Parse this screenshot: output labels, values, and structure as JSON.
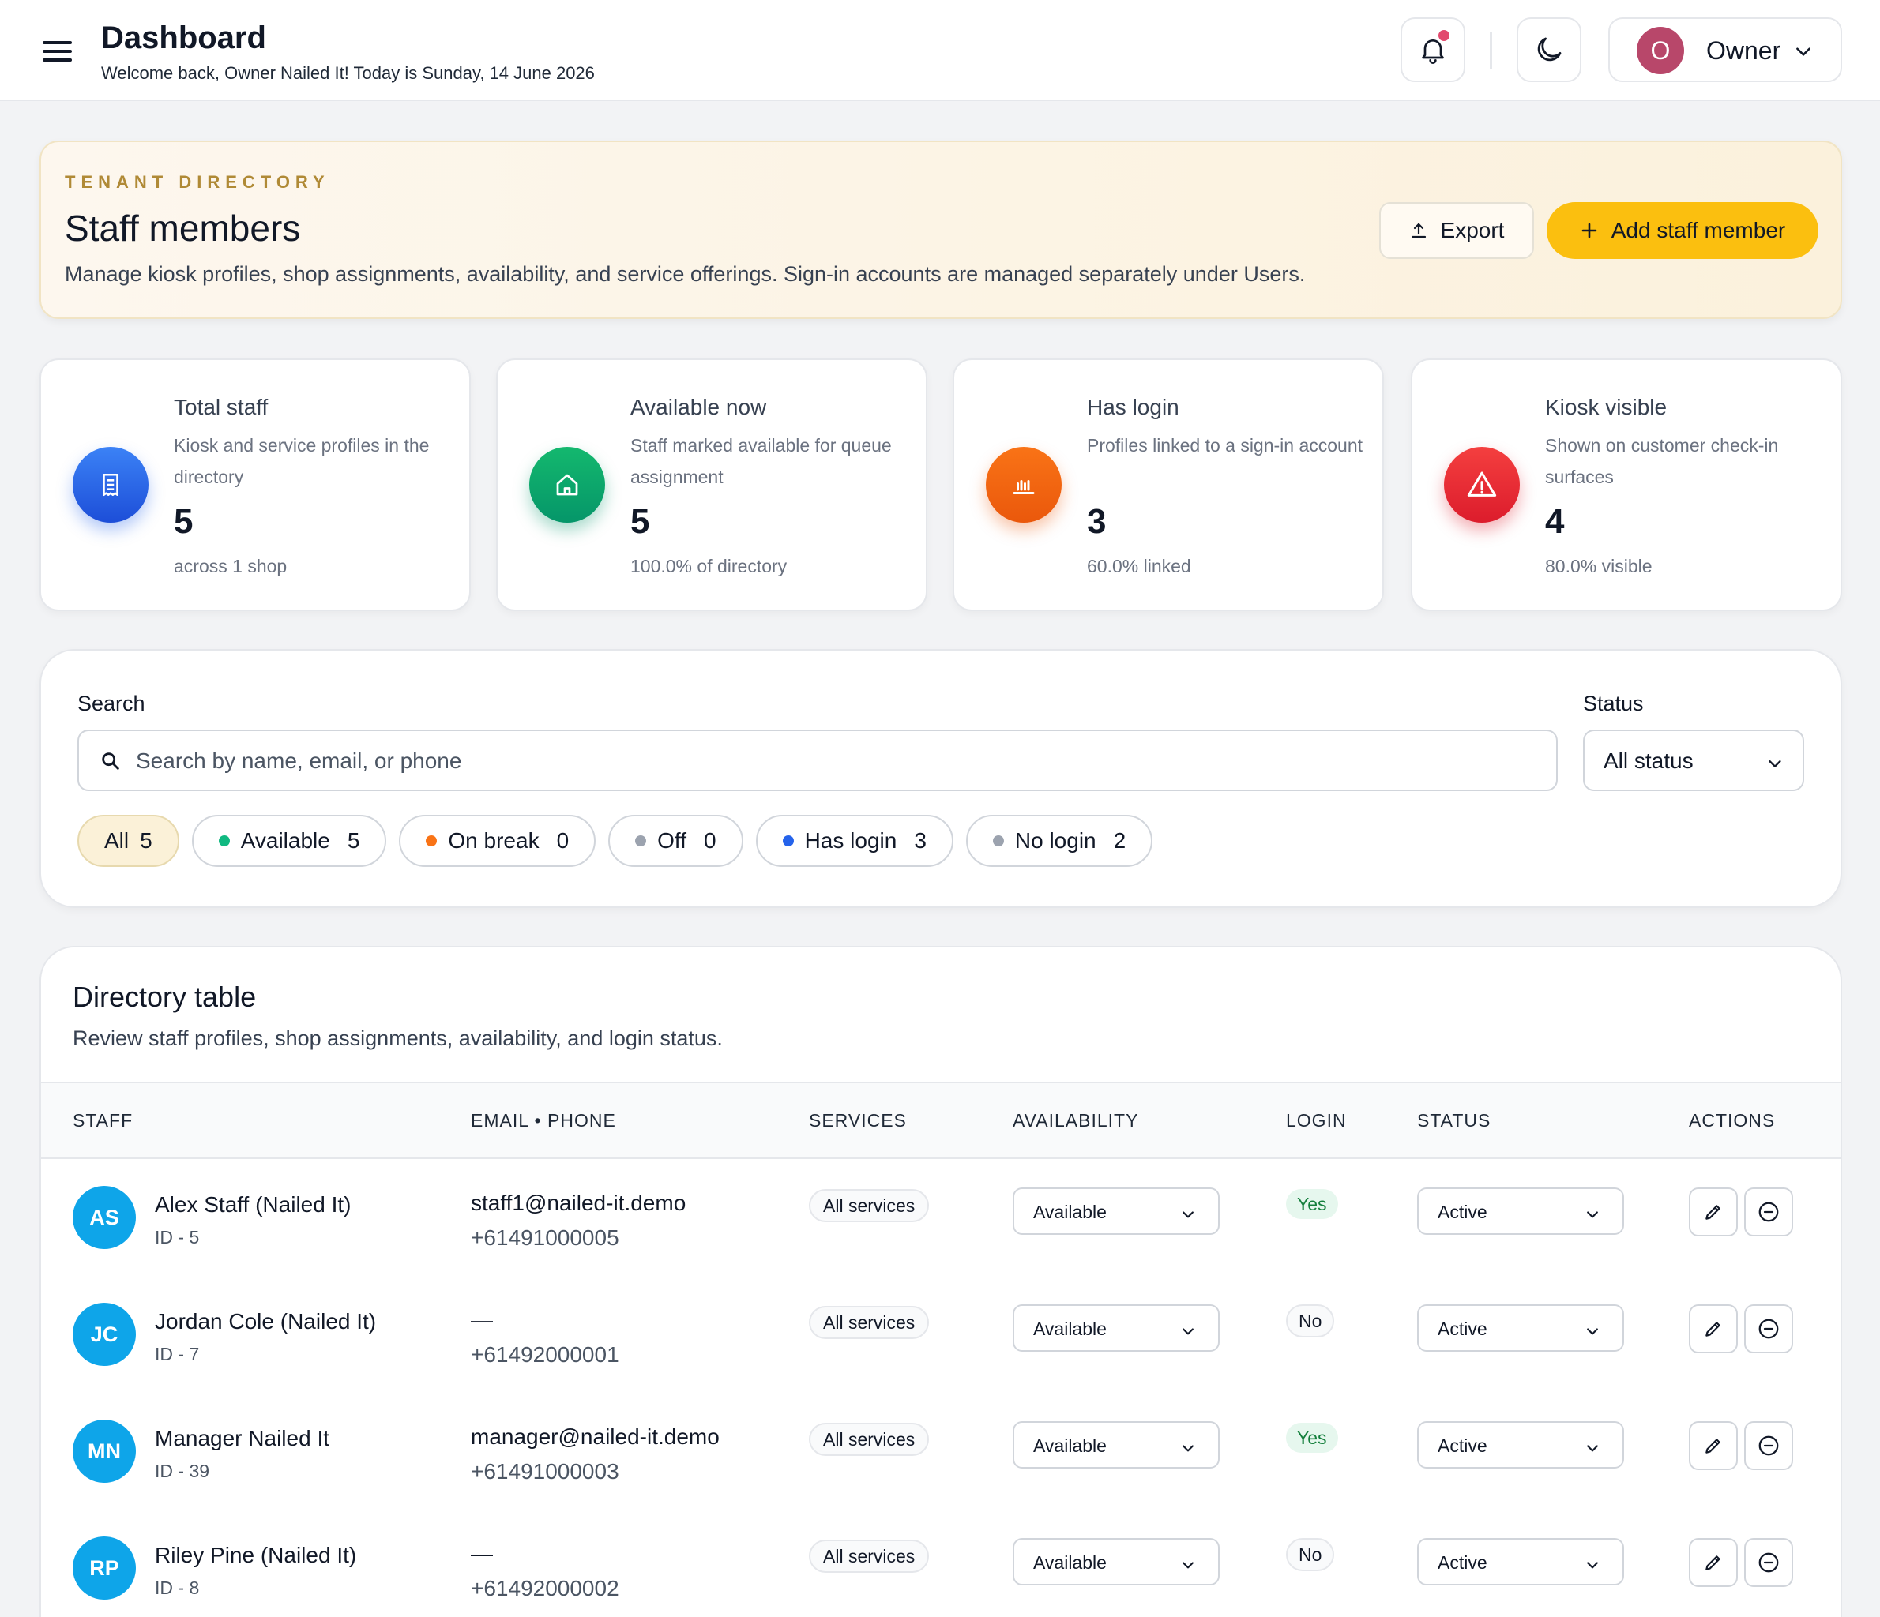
{
  "header": {
    "title": "Dashboard",
    "subtitle": "Welcome back, Owner Nailed It! Today is Sunday, 14 June 2026",
    "user_initial": "O",
    "user_name": "Owner",
    "user_avatar_color": "#b8476a",
    "icons": [
      "menu-icon",
      "bell-icon",
      "moon-icon",
      "chevron-down-icon"
    ]
  },
  "hero": {
    "eyebrow": "TENANT DIRECTORY",
    "title": "Staff members",
    "description": "Manage kiosk profiles, shop assignments, availability, and service offerings. Sign-in accounts are managed separately under Users.",
    "export_label": "Export",
    "add_label": "Add staff member",
    "accent_color": "#fbbf0f"
  },
  "stats": [
    {
      "title": "Total staff",
      "desc": "Kiosk and service profiles in the directory",
      "value": "5",
      "foot": "across 1 shop",
      "icon": "receipt-icon",
      "color": "#2563eb"
    },
    {
      "title": "Available now",
      "desc": "Staff marked available for queue assignment",
      "value": "5",
      "foot": "100.0% of directory",
      "icon": "home-icon",
      "color": "#059669"
    },
    {
      "title": "Has login",
      "desc": "Profiles linked to a sign-in account",
      "value": "3",
      "foot": "60.0% linked",
      "icon": "bar-chart-icon",
      "color": "#ea580c"
    },
    {
      "title": "Kiosk visible",
      "desc": "Shown on customer check-in surfaces",
      "value": "4",
      "foot": "80.0% visible",
      "icon": "warning-icon",
      "color": "#dc1c2c"
    }
  ],
  "filters": {
    "search_label": "Search",
    "search_placeholder": "Search by name, email, or phone",
    "status_label": "Status",
    "status_value": "All status",
    "chips": [
      {
        "label": "All",
        "count": "5",
        "dot": ""
      },
      {
        "label": "Available",
        "count": "5",
        "dot": "#10b981"
      },
      {
        "label": "On break",
        "count": "0",
        "dot": "#f97316"
      },
      {
        "label": "Off",
        "count": "0",
        "dot": "#9ca3af"
      },
      {
        "label": "Has login",
        "count": "3",
        "dot": "#2563eb"
      },
      {
        "label": "No login",
        "count": "2",
        "dot": "#9ca3af"
      }
    ]
  },
  "table": {
    "title": "Directory table",
    "description": "Review staff profiles, shop assignments, availability, and login status.",
    "columns": [
      "STAFF",
      "EMAIL • PHONE",
      "SERVICES",
      "AVAILABILITY",
      "LOGIN",
      "STATUS",
      "ACTIONS"
    ],
    "rows": [
      {
        "initials": "AS",
        "name": "Alex Staff (Nailed It)",
        "id": "ID - 5",
        "email": "staff1@nailed-it.demo",
        "phone": "+61491000005",
        "services": "All services",
        "availability": "Available",
        "login": "Yes",
        "status": "Active"
      },
      {
        "initials": "JC",
        "name": "Jordan Cole (Nailed It)",
        "id": "ID - 7",
        "email": "—",
        "phone": "+61492000001",
        "services": "All services",
        "availability": "Available",
        "login": "No",
        "status": "Active"
      },
      {
        "initials": "MN",
        "name": "Manager Nailed It",
        "id": "ID - 39",
        "email": "manager@nailed-it.demo",
        "phone": "+61491000003",
        "services": "All services",
        "availability": "Available",
        "login": "Yes",
        "status": "Active"
      },
      {
        "initials": "RP",
        "name": "Riley Pine (Nailed It)",
        "id": "ID - 8",
        "email": "—",
        "phone": "+61492000002",
        "services": "All services",
        "availability": "Available",
        "login": "No",
        "status": "Active"
      }
    ]
  }
}
